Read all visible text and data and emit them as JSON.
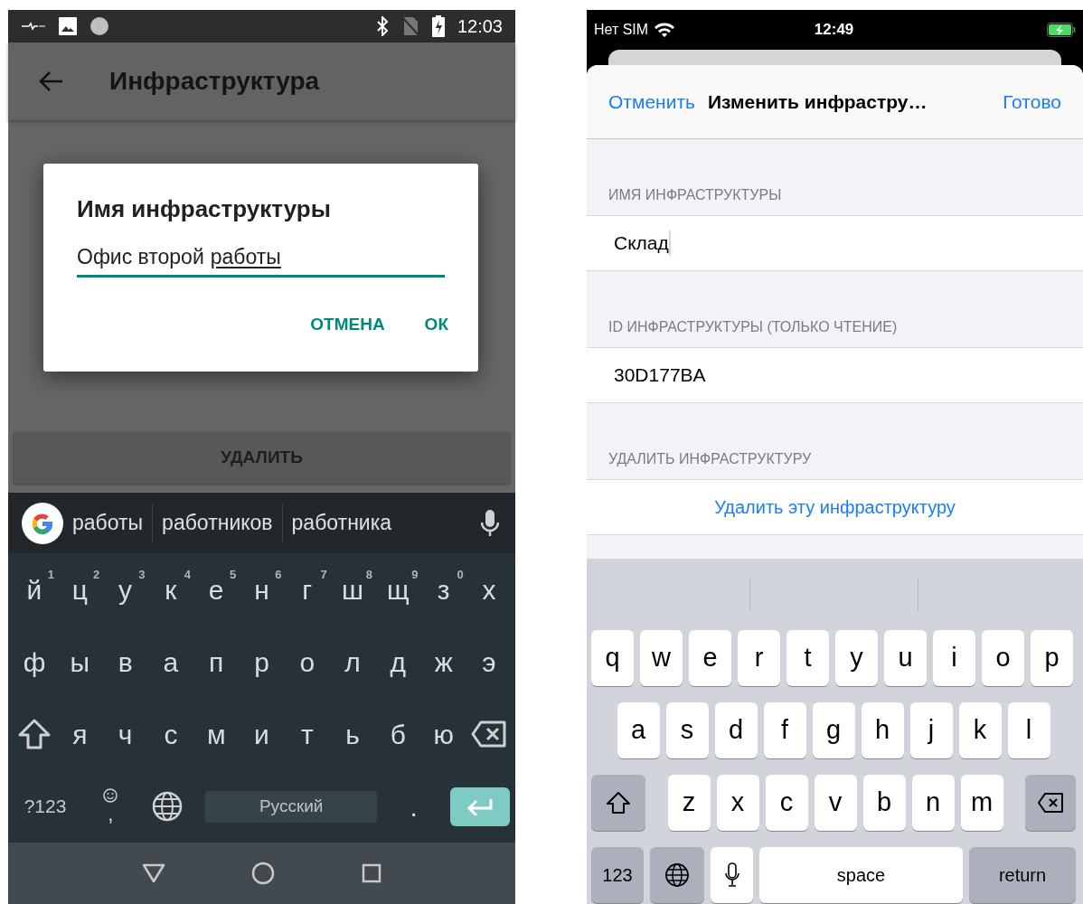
{
  "left_phone": {
    "status_bar": {
      "time": "12:03"
    },
    "app_bar": {
      "title": "Инфраструктура"
    },
    "dialog": {
      "title": "Имя инфраструктуры",
      "field": {
        "focused": true,
        "parts": [
          {
            "text": "Офис второй",
            "underlined": false
          },
          {
            "text": "работы",
            "underlined": true
          }
        ]
      },
      "buttons": [
        "ОТМЕНА",
        "ОК"
      ]
    },
    "delete_button": "УДАЛИТЬ",
    "keyboard": {
      "suggestions": [
        "работы",
        "работников",
        "работника"
      ],
      "rows": [
        [
          {
            "kind": "letter",
            "label": "й",
            "hint": "1"
          },
          {
            "kind": "letter",
            "label": "ц",
            "hint": "2"
          },
          {
            "kind": "letter",
            "label": "у",
            "hint": "3"
          },
          {
            "kind": "letter",
            "label": "к",
            "hint": "4"
          },
          {
            "kind": "letter",
            "label": "е",
            "hint": "5"
          },
          {
            "kind": "letter",
            "label": "н",
            "hint": "6"
          },
          {
            "kind": "letter",
            "label": "г",
            "hint": "7"
          },
          {
            "kind": "letter",
            "label": "ш",
            "hint": "8"
          },
          {
            "kind": "letter",
            "label": "щ",
            "hint": "9"
          },
          {
            "kind": "letter",
            "label": "з",
            "hint": "0"
          },
          {
            "kind": "letter",
            "label": "х"
          }
        ],
        [
          {
            "kind": "letter",
            "label": "ф"
          },
          {
            "kind": "letter",
            "label": "ы"
          },
          {
            "kind": "letter",
            "label": "в"
          },
          {
            "kind": "letter",
            "label": "а"
          },
          {
            "kind": "letter",
            "label": "п"
          },
          {
            "kind": "letter",
            "label": "р"
          },
          {
            "kind": "letter",
            "label": "о"
          },
          {
            "kind": "letter",
            "label": "л"
          },
          {
            "kind": "letter",
            "label": "д"
          },
          {
            "kind": "letter",
            "label": "ж"
          },
          {
            "kind": "letter",
            "label": "э"
          }
        ],
        [
          {
            "kind": "shift"
          },
          {
            "kind": "letter",
            "label": "я"
          },
          {
            "kind": "letter",
            "label": "ч"
          },
          {
            "kind": "letter",
            "label": "с"
          },
          {
            "kind": "letter",
            "label": "м"
          },
          {
            "kind": "letter",
            "label": "и"
          },
          {
            "kind": "letter",
            "label": "т"
          },
          {
            "kind": "letter",
            "label": "ь"
          },
          {
            "kind": "letter",
            "label": "б"
          },
          {
            "kind": "letter",
            "label": "ю"
          },
          {
            "kind": "backspace"
          }
        ]
      ],
      "bottom_bar": [
        {
          "kind": "symbols",
          "label": "?123"
        },
        {
          "kind": "emoji_comma",
          "label": ","
        },
        {
          "kind": "globe"
        },
        {
          "kind": "space",
          "label": "Русский"
        },
        {
          "kind": "letter",
          "label": "."
        },
        {
          "kind": "enter"
        }
      ]
    }
  },
  "right_phone": {
    "status_bar": {
      "carrier": "Нет SIM",
      "time": "12:49"
    },
    "nav_bar": {
      "cancel": "Отменить",
      "title": "Изменить инфрастру…",
      "done": "Готово"
    },
    "sections": [
      {
        "header": "ИМЯ ИНФРАСТРУКТУРЫ",
        "kind": "input",
        "value": "Склад",
        "focused": true
      },
      {
        "header": "ID ИНФРАСТРУКТУРЫ (ТОЛЬКО ЧТЕНИЕ)",
        "kind": "text",
        "value": "30D177BA"
      },
      {
        "header": "УДАЛИТЬ ИНФРАСТРУКТУРУ",
        "kind": "action",
        "value": "Удалить эту инфраструктуру"
      }
    ],
    "keyboard": {
      "rows": [
        [
          {
            "kind": "letter",
            "label": "q"
          },
          {
            "kind": "letter",
            "label": "w"
          },
          {
            "kind": "letter",
            "label": "e"
          },
          {
            "kind": "letter",
            "label": "r"
          },
          {
            "kind": "letter",
            "label": "t"
          },
          {
            "kind": "letter",
            "label": "y"
          },
          {
            "kind": "letter",
            "label": "u"
          },
          {
            "kind": "letter",
            "label": "i"
          },
          {
            "kind": "letter",
            "label": "o"
          },
          {
            "kind": "letter",
            "label": "p"
          }
        ],
        [
          {
            "kind": "letter",
            "label": "a"
          },
          {
            "kind": "letter",
            "label": "s"
          },
          {
            "kind": "letter",
            "label": "d"
          },
          {
            "kind": "letter",
            "label": "f"
          },
          {
            "kind": "letter",
            "label": "g"
          },
          {
            "kind": "letter",
            "label": "h"
          },
          {
            "kind": "letter",
            "label": "j"
          },
          {
            "kind": "letter",
            "label": "k"
          },
          {
            "kind": "letter",
            "label": "l"
          }
        ],
        [
          {
            "kind": "shift"
          },
          {
            "kind": "letter",
            "label": "z"
          },
          {
            "kind": "letter",
            "label": "x"
          },
          {
            "kind": "letter",
            "label": "c"
          },
          {
            "kind": "letter",
            "label": "v"
          },
          {
            "kind": "letter",
            "label": "b"
          },
          {
            "kind": "letter",
            "label": "n"
          },
          {
            "kind": "letter",
            "label": "m"
          },
          {
            "kind": "backspace"
          }
        ]
      ],
      "bottom_bar": [
        {
          "kind": "numbers",
          "label": "123"
        },
        {
          "kind": "globe"
        },
        {
          "kind": "mic"
        },
        {
          "kind": "space",
          "label": "space"
        },
        {
          "kind": "return",
          "label": "return"
        }
      ]
    }
  }
}
